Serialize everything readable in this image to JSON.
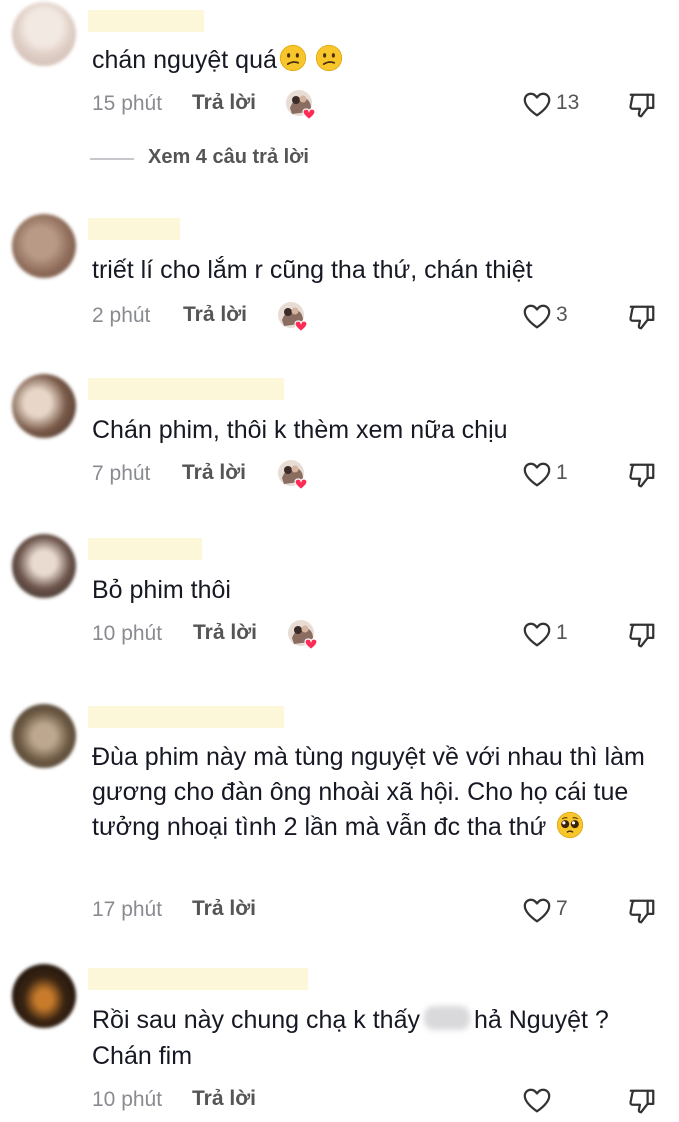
{
  "colors": {
    "redact": "#fbf7d8",
    "muted": "#8a8b91",
    "text": "#161823",
    "heart_red": "#fe2c55"
  },
  "comments": [
    {
      "text": "chán nguyệt quá",
      "time": "15 phút",
      "reply_label": "Trả lời",
      "like_count": "13",
      "creator_liked": true,
      "view_replies": "Xem 4 câu trả lời"
    },
    {
      "text": "triết lí cho lắm r cũng tha thứ, chán thiệt",
      "time": "2 phút",
      "reply_label": "Trả lời",
      "like_count": "3",
      "creator_liked": true
    },
    {
      "text": "Chán phim, thôi k thèm xem nữa chịu",
      "time": "7 phút",
      "reply_label": "Trả lời",
      "like_count": "1",
      "creator_liked": true
    },
    {
      "text": "Bỏ phim thôi",
      "time": "10 phút",
      "reply_label": "Trả lời",
      "like_count": "1",
      "creator_liked": true
    },
    {
      "text": "Đùa phim này mà tùng nguyệt về với nhau thì làm gương cho đàn ông nhoài xã hội. Cho họ cái tue tưởng nhoại tình 2 lần mà vẫn đc tha thứ",
      "time": "17 phút",
      "reply_label": "Trả lời",
      "like_count": "7",
      "creator_liked": false
    },
    {
      "text_before_blur": "Rồi sau này chung chạ k thấy",
      "text_after_blur": "hả Nguyệt ?",
      "text_line2": "Chán fim",
      "time": "10 phút",
      "reply_label": "Trả lời",
      "like_count": "",
      "creator_liked": false
    }
  ],
  "icons": {
    "like": "heart-outline-icon",
    "dislike": "thumbs-down-icon",
    "creator": "creator-liked-avatar-icon",
    "emoji_confused": "confused-face-emoji",
    "emoji_pleading": "pleading-face-emoji"
  }
}
